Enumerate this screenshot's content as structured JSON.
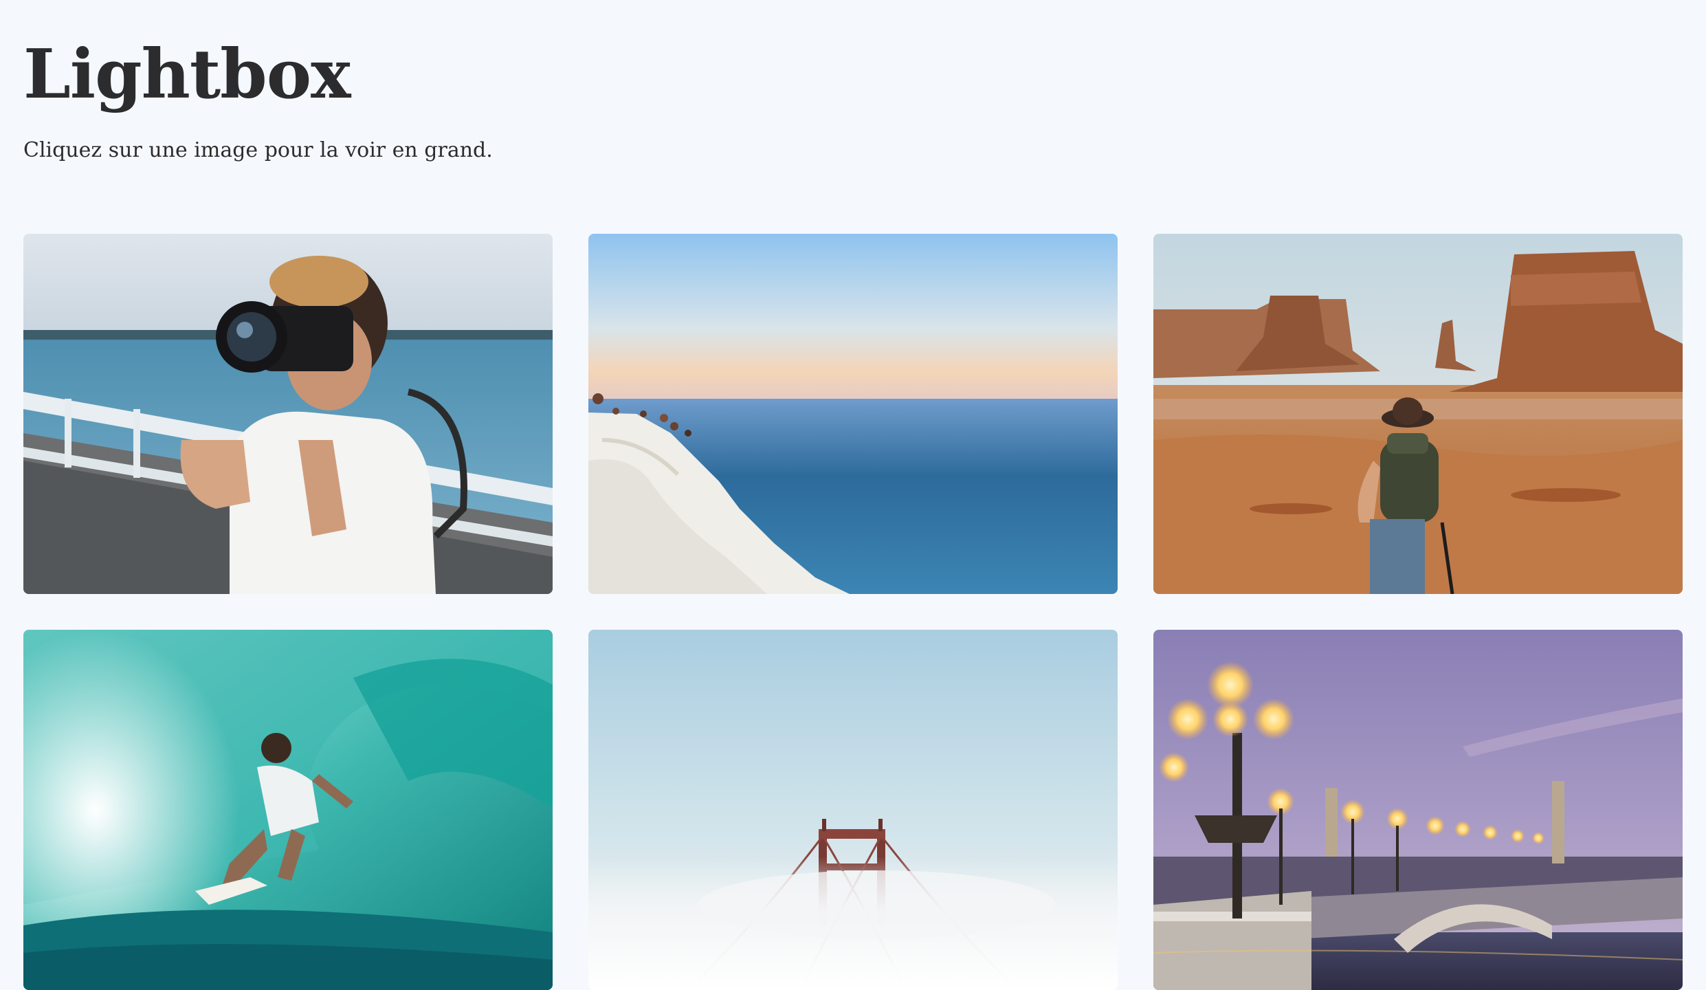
{
  "page": {
    "title": "Lightbox",
    "subtitle": "Cliquez sur une image pour la voir en grand."
  },
  "gallery": {
    "images": [
      {
        "name": "photographer-on-pier"
      },
      {
        "name": "white-cliffs-by-sea"
      },
      {
        "name": "hiker-in-desert-buttes"
      },
      {
        "name": "surfer-in-wave-barrel"
      },
      {
        "name": "bridge-tower-in-fog"
      },
      {
        "name": "bridge-with-street-lamps-at-dusk"
      }
    ]
  }
}
